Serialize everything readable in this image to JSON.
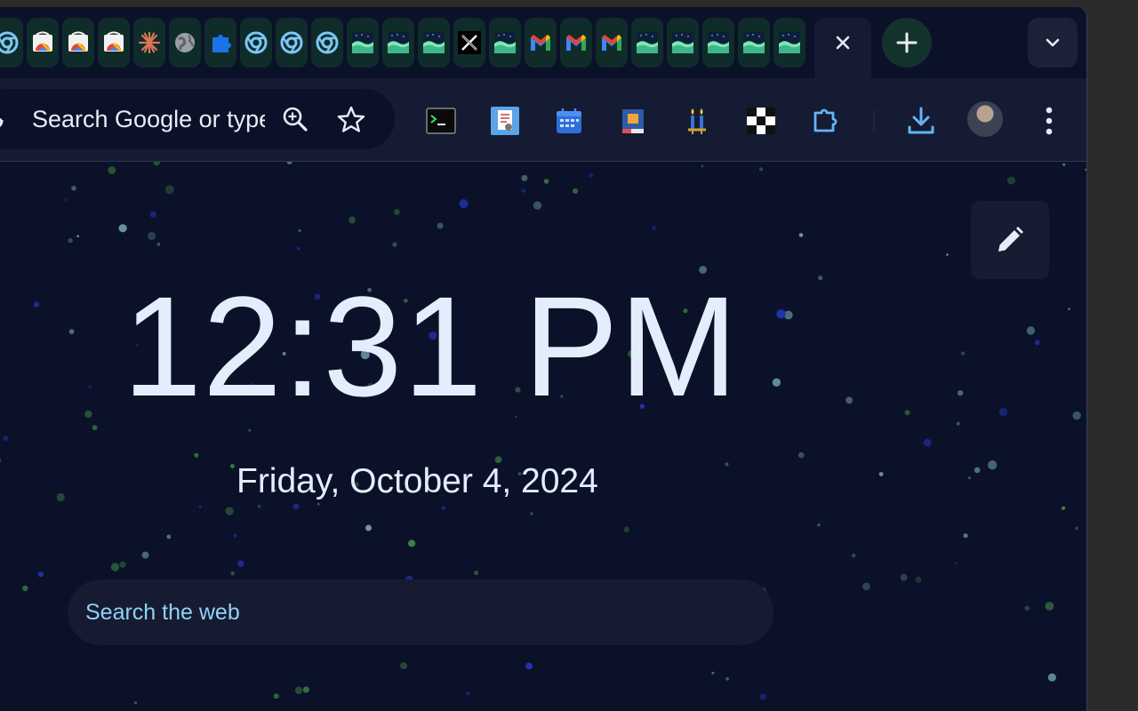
{
  "colors": {
    "window_bg": "#0b1128",
    "toolbar_bg": "#141b33",
    "accent_blue": "#64b5f6",
    "text_light": "#e3eefc",
    "search_placeholder": "#8fd2f7"
  },
  "tabstrip": {
    "tabs": [
      {
        "icon": "chrome-icon"
      },
      {
        "icon": "chrome-web-store-icon"
      },
      {
        "icon": "chrome-web-store-icon"
      },
      {
        "icon": "chrome-web-store-icon"
      },
      {
        "icon": "claude-icon"
      },
      {
        "icon": "globe-icon"
      },
      {
        "icon": "extensions-puzzle-icon"
      },
      {
        "icon": "chrome-icon"
      },
      {
        "icon": "chrome-icon"
      },
      {
        "icon": "chrome-icon"
      },
      {
        "icon": "wave-icon"
      },
      {
        "icon": "wave-icon"
      },
      {
        "icon": "wave-icon"
      },
      {
        "icon": "x-icon"
      },
      {
        "icon": "wave-icon"
      },
      {
        "icon": "gmail-icon"
      },
      {
        "icon": "gmail-icon"
      },
      {
        "icon": "gmail-icon"
      },
      {
        "icon": "wave-icon"
      },
      {
        "icon": "wave-icon"
      },
      {
        "icon": "wave-icon"
      },
      {
        "icon": "wave-icon"
      },
      {
        "icon": "wave-icon"
      }
    ],
    "active_tab_close_icon": "close-icon",
    "new_tab_icon": "plus-icon",
    "tab_search_icon": "chevron-down-icon"
  },
  "toolbar": {
    "omnibox_text": "Search Google or type a URL",
    "zoom_icon": "zoom-icon",
    "bookmark_icon": "star-icon",
    "extensions": [
      "terminal-icon",
      "pdf-editor-icon",
      "calendar-icon",
      "book-icon",
      "candles-icon",
      "crossword-icon",
      "extensions-puzzle-icon"
    ],
    "download_icon": "download-icon",
    "profile_icon": "avatar",
    "menu_icon": "kebab-menu-icon"
  },
  "ntp": {
    "time": "12:31 PM",
    "date": "Friday, October 4, 2024",
    "search_placeholder": "Search the web",
    "edit_icon": "pencil-icon"
  }
}
